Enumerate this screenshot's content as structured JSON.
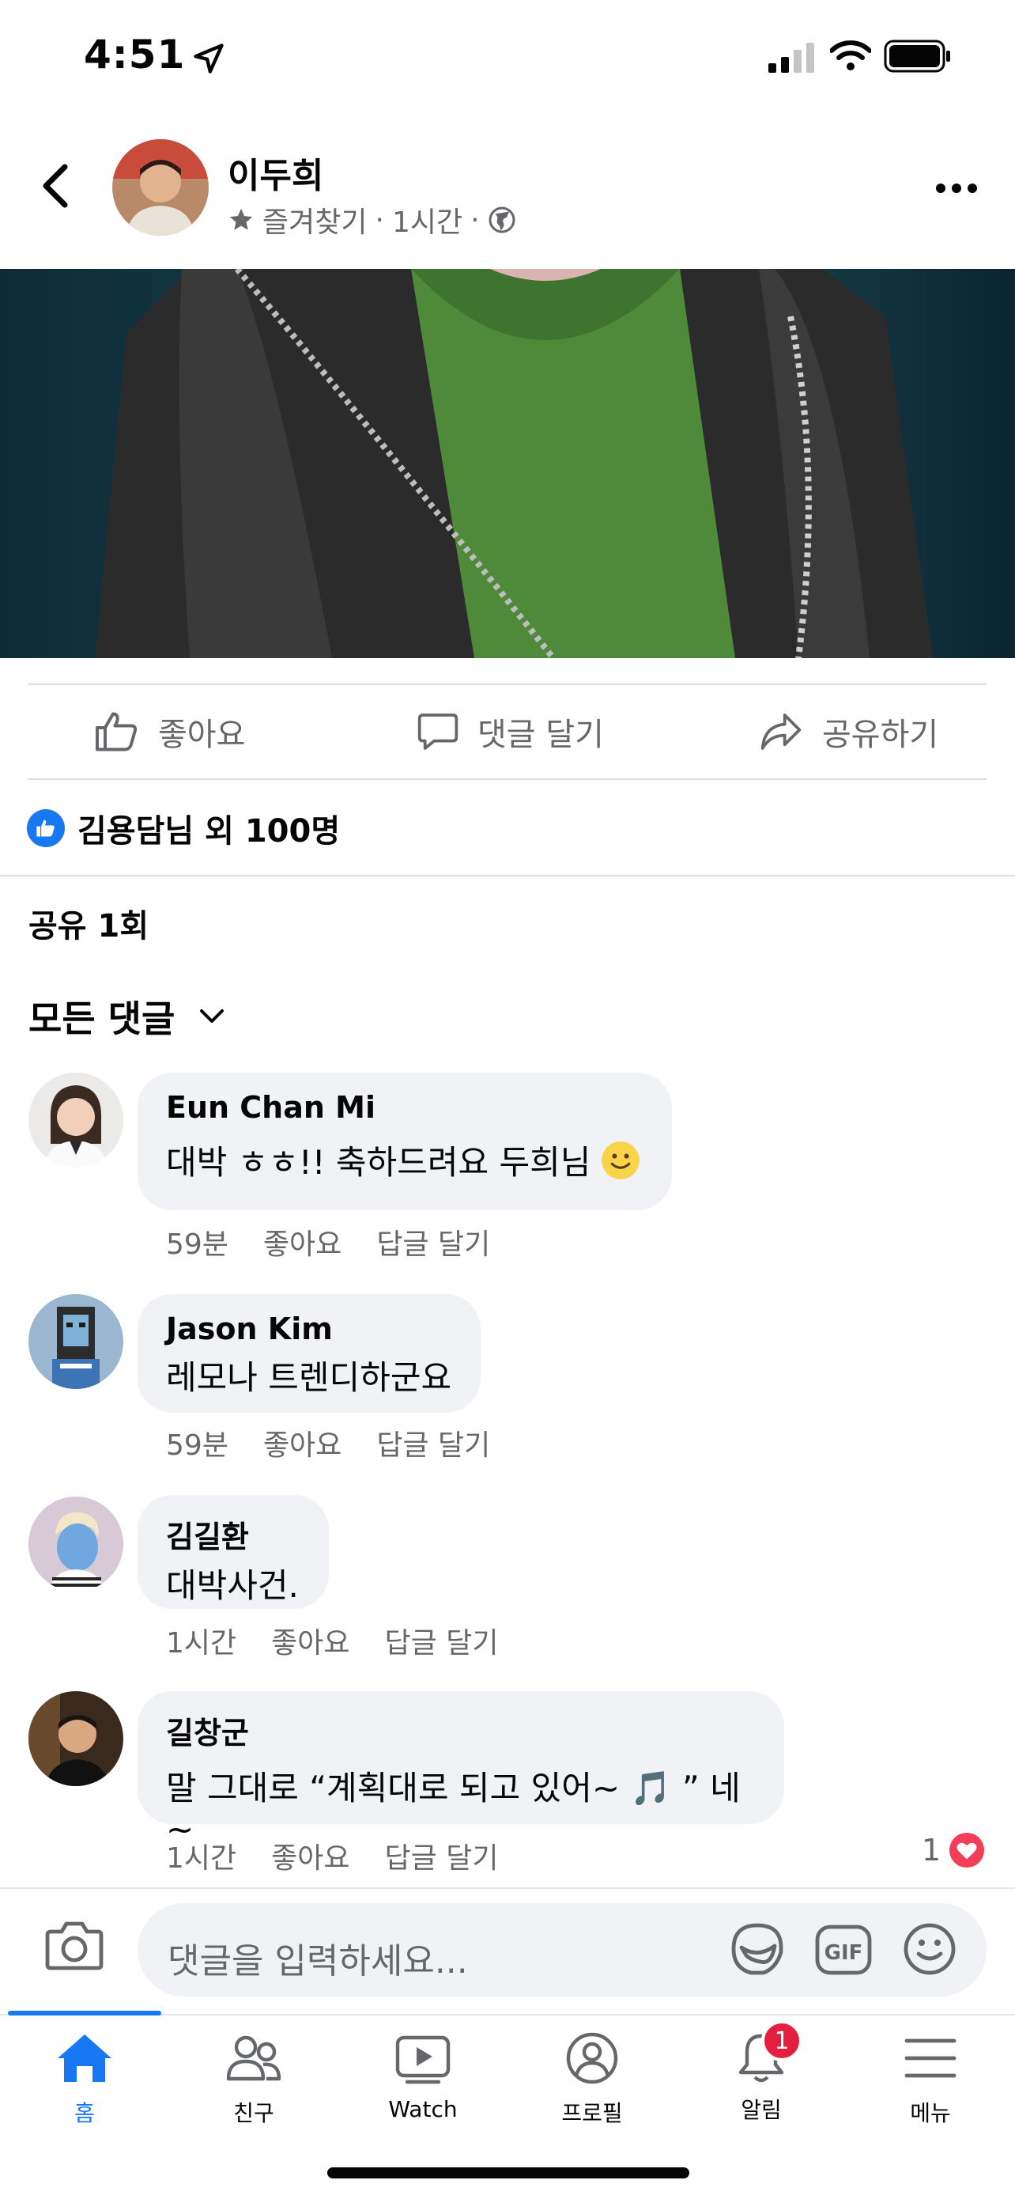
{
  "status_bar": {
    "time": "4:51"
  },
  "post": {
    "author": "이두희",
    "favorite_label": "즐겨찾기",
    "time": "1시간",
    "separator": "·"
  },
  "actions": {
    "like": "좋아요",
    "comment": "댓글 달기",
    "share": "공유하기"
  },
  "reactions": {
    "summary": "김용담님 외 100명"
  },
  "shares": "공유 1회",
  "comments_sort": "모든 댓글",
  "comments": [
    {
      "name": "Eun Chan Mi",
      "text": "대박 ㅎㅎ!! 축하드려요 두희님",
      "time": "59분",
      "like": "좋아요",
      "reply": "답글 달기"
    },
    {
      "name": "Jason Kim",
      "text": "레모나 트렌디하군요",
      "time": "59분",
      "like": "좋아요",
      "reply": "답글 달기"
    },
    {
      "name": "김길환",
      "text": "대박사건.",
      "time": "1시간",
      "like": "좋아요",
      "reply": "답글 달기"
    },
    {
      "name": "길창군",
      "text": "말 그대로 “계획대로 되고 있어~ 🎵 ” 네~",
      "time": "1시간",
      "like": "좋아요",
      "reply": "답글 달기",
      "reaction_count": "1"
    }
  ],
  "composer": {
    "placeholder": "댓글을 입력하세요..."
  },
  "tabs": [
    {
      "label": "홈",
      "icon": "home-icon",
      "active": true
    },
    {
      "label": "친구",
      "icon": "friends-icon"
    },
    {
      "label": "Watch",
      "icon": "watch-icon"
    },
    {
      "label": "프로필",
      "icon": "profile-icon"
    },
    {
      "label": "알림",
      "icon": "bell-icon",
      "badge": "1"
    },
    {
      "label": "메뉴",
      "icon": "menu-icon"
    }
  ],
  "colors": {
    "accent": "#1877f2",
    "bubble": "#f0f2f5",
    "muted": "#65676b",
    "badge": "#e41e3f"
  }
}
